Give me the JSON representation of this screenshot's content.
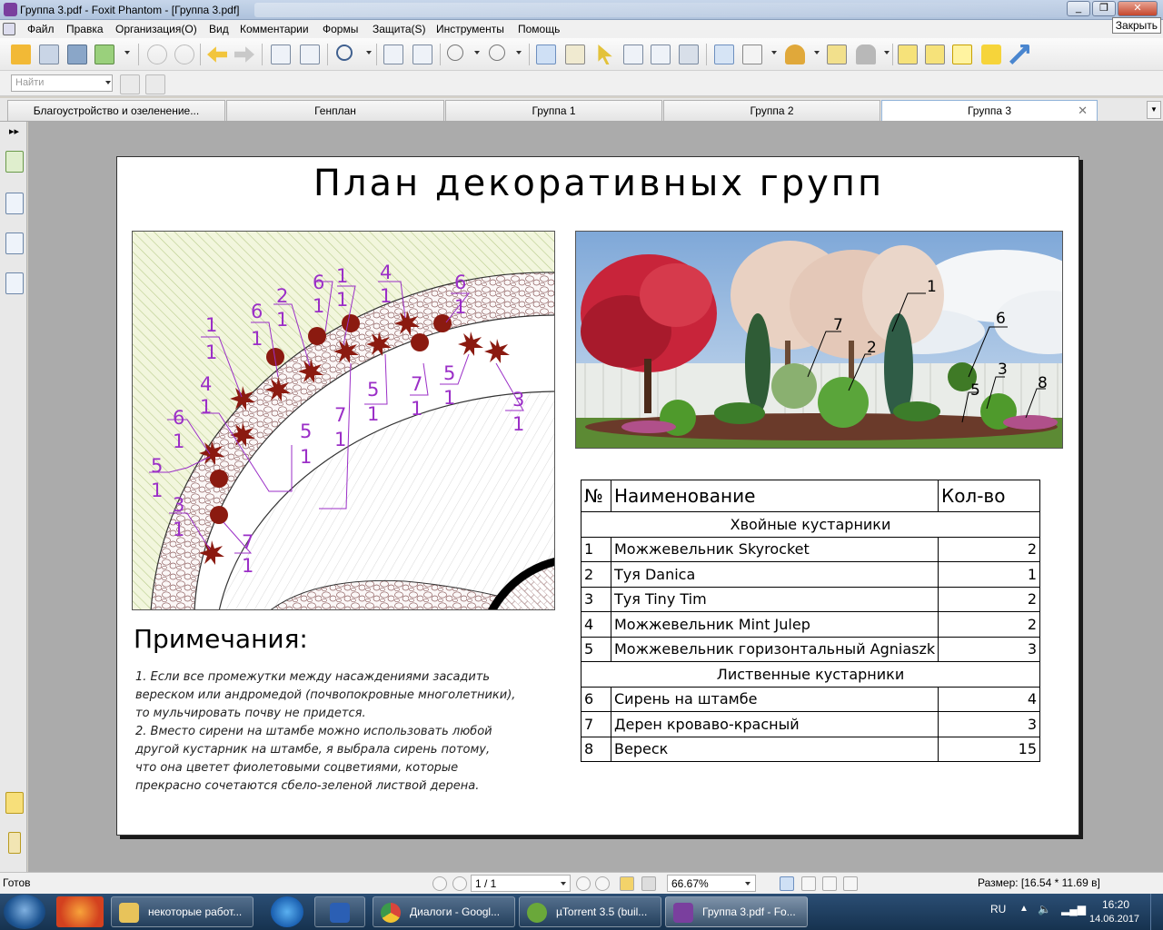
{
  "window": {
    "title": "Группа 3.pdf - Foxit Phantom - [Группа 3.pdf]",
    "close_tooltip": "Закрыть"
  },
  "menu": [
    "Файл",
    "Правка",
    "Организация(О)",
    "Вид",
    "Комментарии",
    "Формы",
    "Защита(S)",
    "Инструменты",
    "Помощь"
  ],
  "find": {
    "placeholder": "Найти"
  },
  "tabs": [
    {
      "label": "Благоустройство и озеленение..."
    },
    {
      "label": "Генплан"
    },
    {
      "label": "Группа 1"
    },
    {
      "label": "Группа 2"
    },
    {
      "label": "Группа 3",
      "active": true
    }
  ],
  "document": {
    "title": "План декоративных групп",
    "notes_title": "Примечания:",
    "notes": [
      "1. Если все промежутки между насаждениями засадить",
      "вереском или андромедой (почвопокровные многолетники),",
      "то мульчировать почву не придется.",
      "2. Вместо сирени на штамбе можно использовать любой",
      "другой кустарник на штамбе, я выбрала сирень потому,",
      "что она цветет фиолетовыми соцветиями, которые",
      "прекрасно сочетаются сбело-зеленой листвой дерена."
    ],
    "table": {
      "headers": [
        "№",
        "Наименование",
        "Кол-во"
      ],
      "groups": [
        {
          "name": "Хвойные кустарники",
          "rows": [
            {
              "num": "1",
              "name": "Можжевельник Skyrocket",
              "qty": "2"
            },
            {
              "num": "2",
              "name": "Туя Danica",
              "qty": "1"
            },
            {
              "num": "3",
              "name": "Туя Tiny Tim",
              "qty": "2"
            },
            {
              "num": "4",
              "name": "Можжевельник Mint Julep",
              "qty": "2"
            },
            {
              "num": "5",
              "name": "Можжевельник горизонтальный Agniaszk",
              "qty": "3"
            }
          ]
        },
        {
          "name": "Лиственные кустарники",
          "rows": [
            {
              "num": "6",
              "name": "Сирень на штамбе",
              "qty": "4"
            },
            {
              "num": "7",
              "name": "Дерен кроваво-красный",
              "qty": "3"
            },
            {
              "num": "8",
              "name": "Вереск",
              "qty": "15"
            }
          ]
        }
      ]
    },
    "plan_labels": [
      {
        "top": "1",
        "bottom": "1"
      },
      {
        "top": "6",
        "bottom": "1"
      },
      {
        "top": "2",
        "bottom": "1"
      },
      {
        "top": "6",
        "bottom": "1"
      },
      {
        "top": "1",
        "bottom": "1"
      },
      {
        "top": "4",
        "bottom": "1"
      },
      {
        "top": "6",
        "bottom": "1"
      },
      {
        "top": "4",
        "bottom": "1"
      },
      {
        "top": "6",
        "bottom": "1"
      },
      {
        "top": "5",
        "bottom": "1"
      },
      {
        "top": "3",
        "bottom": "1"
      },
      {
        "top": "5",
        "bottom": "1"
      },
      {
        "top": "7",
        "bottom": "1"
      },
      {
        "top": "5",
        "bottom": "1"
      },
      {
        "top": "7",
        "bottom": "1"
      },
      {
        "top": "5",
        "bottom": "1"
      },
      {
        "top": "7",
        "bottom": "1"
      },
      {
        "top": "3",
        "bottom": "1"
      }
    ],
    "photo_labels": [
      "1",
      "7",
      "2",
      "6",
      "3",
      "5",
      "8"
    ]
  },
  "status": {
    "ready": "Готов",
    "page": "1 / 1",
    "zoom": "66.67%",
    "size": "Размер: [16.54 * 11.69 в]"
  },
  "taskbar": {
    "tasks": [
      {
        "label": "некоторые работ...",
        "icon": "folder-icon",
        "color": "#e8c35a"
      },
      {
        "label": "",
        "icon": "word-icon",
        "color": "#2b5fb4"
      },
      {
        "label": "Диалоги - Googl...",
        "icon": "chrome-icon",
        "color": "#d9453b"
      },
      {
        "label": "µTorrent 3.5  (buil...",
        "icon": "utorrent-icon",
        "color": "#6aa83a"
      },
      {
        "label": "Группа 3.pdf - Fo...",
        "icon": "foxit-icon",
        "color": "#7a3f9e",
        "active": true
      }
    ],
    "lang": "RU",
    "time": "16:20",
    "date": "14.06.2017"
  },
  "colors": {
    "accent_purple": "#9b2fc7",
    "shrub_red": "#8b1a10"
  }
}
